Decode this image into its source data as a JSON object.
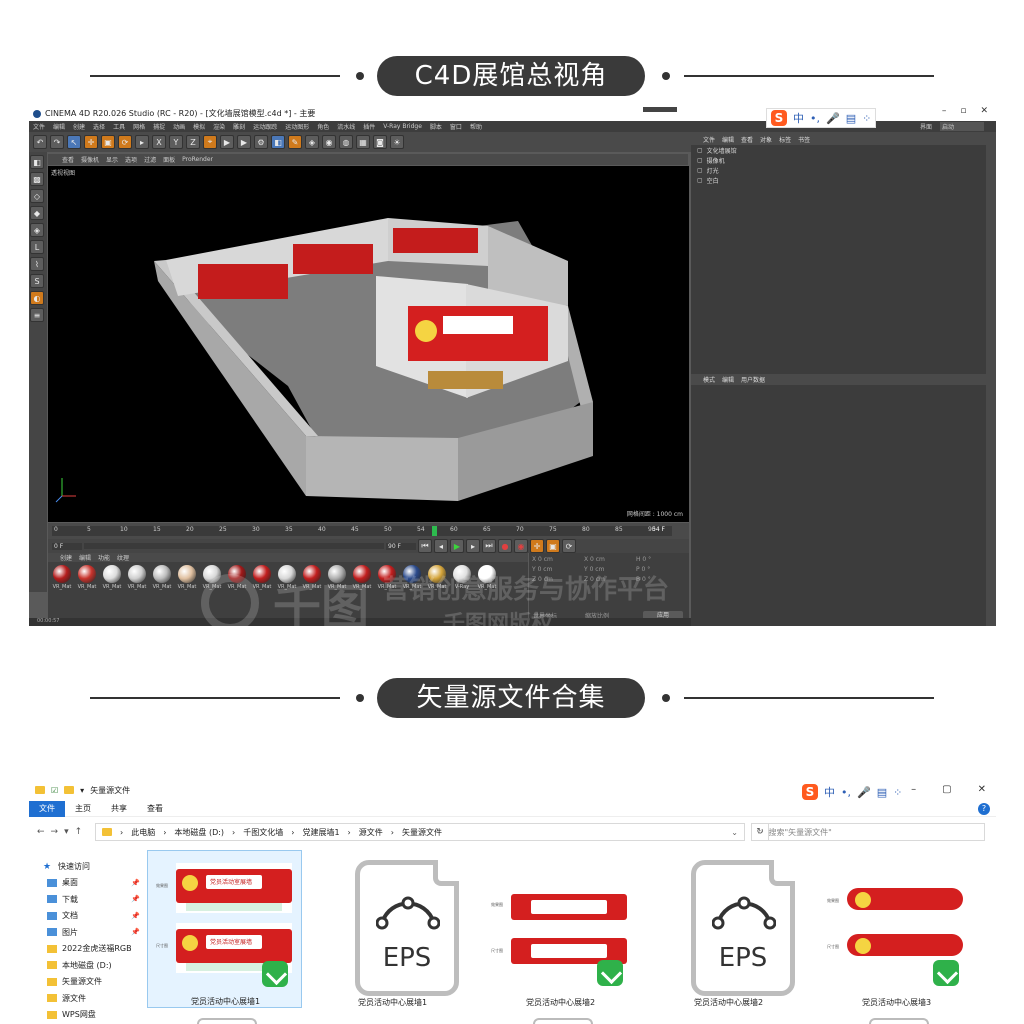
{
  "sections": {
    "c4d_title": "C4D展馆总视角",
    "vector_title": "矢量源文件合集"
  },
  "c4d": {
    "window_title": "CINEMA 4D R20.026 Studio (RC - R20) - [文化墙展馆模型.c4d *] - 主要",
    "menu": [
      "文件",
      "编辑",
      "创建",
      "选择",
      "工具",
      "网格",
      "捕捉",
      "动画",
      "模拟",
      "渲染",
      "雕刻",
      "运动跟踪",
      "运动图形",
      "角色",
      "流水线",
      "插件",
      "V-Ray Bridge",
      "脚本",
      "窗口",
      "帮助"
    ],
    "layout_label": "界面",
    "layout_value": "启动",
    "viewport_tabs": [
      "查看",
      "摄像机",
      "显示",
      "选项",
      "过滤",
      "面板",
      "ProRender"
    ],
    "viewport_name": "透视视图",
    "grid_spacing": "网格间距 : 1000 cm",
    "timeline_ticks": [
      "0",
      "5",
      "10",
      "15",
      "20",
      "25",
      "30",
      "35",
      "40",
      "45",
      "50",
      "54",
      "60",
      "65",
      "70",
      "75",
      "80",
      "85",
      "90"
    ],
    "current_frame": "54 F",
    "frame_start": "0 F",
    "frame_end": "90 F",
    "material_tabs": [
      "创建",
      "编辑",
      "功能",
      "纹理"
    ],
    "material_label": "VR_Mat",
    "material_labels": [
      "VR_Mat",
      "VR_Mat",
      "VR_Mat",
      "VR_Mat",
      "VR_Mat",
      "VR_Mat",
      "VR_Mat",
      "VR_Mat",
      "VR_Mat",
      "VR_Mat",
      "VR_Mat",
      "VR_Mat",
      "VR_Mat",
      "VR_Mat",
      "VR_Mat",
      "VR_Mat",
      "V-Ray",
      "VR_Mat"
    ],
    "coord_labels": [
      "X",
      "Y",
      "Z",
      "X",
      "Y",
      "Z",
      "H",
      "P",
      "B"
    ],
    "coord_value": "0 cm",
    "coord_angle": "0 °",
    "coord_mode": "世界坐标",
    "coord_scale": "缩放比例",
    "apply_label": "应用",
    "object_tabs": [
      "文件",
      "编辑",
      "查看",
      "对象",
      "标签",
      "书签"
    ],
    "objects": [
      "文化墙展馆",
      "摄像机",
      "灯光",
      "空白"
    ],
    "attr_tabs": [
      "模式",
      "编辑",
      "用户数据"
    ],
    "status_time": "00:00:57",
    "maxon_label": "MAXON CINEMA 4D"
  },
  "ime": {
    "logo": "S",
    "items": [
      "中",
      "•,",
      "🎤",
      "▤",
      "⁘"
    ]
  },
  "watermark": {
    "logo_text": "千图",
    "slogan": "营销创意服务与协作平台",
    "sub": "千图网版权"
  },
  "explorer": {
    "window_title": "矢量源文件",
    "ribbon_tabs": [
      "文件",
      "主页",
      "共享",
      "查看"
    ],
    "breadcrumb": [
      "此电脑",
      "本地磁盘 (D:)",
      "千图文化墙",
      "党建展墙1",
      "源文件",
      "矢量源文件"
    ],
    "search_placeholder": "搜索\"矢量源文件\"",
    "nav_items": [
      {
        "label": "快速访问",
        "pinned": false
      },
      {
        "label": "桌面",
        "pinned": true
      },
      {
        "label": "下载",
        "pinned": true
      },
      {
        "label": "文档",
        "pinned": true
      },
      {
        "label": "图片",
        "pinned": true
      },
      {
        "label": "2022金虎送福RGB",
        "pinned": false
      },
      {
        "label": "本地磁盘 (D:)",
        "pinned": false
      },
      {
        "label": "矢量源文件",
        "pinned": false
      },
      {
        "label": "源文件",
        "pinned": false
      },
      {
        "label": "WPS网盘",
        "pinned": false
      }
    ],
    "files": [
      {
        "name": "党员活动中心展墙1",
        "type": "cdr"
      },
      {
        "name": "党员活动中心展墙1",
        "type": "eps"
      },
      {
        "name": "党员活动中心展墙2",
        "type": "cdr"
      },
      {
        "name": "党员活动中心展墙2",
        "type": "eps"
      },
      {
        "name": "党员活动中心展墙3",
        "type": "cdr"
      }
    ],
    "eps_label": "EPS",
    "board_label_top": "效果图",
    "board_label_bottom": "尺寸图",
    "board_text": "党员活动室展墙"
  },
  "colors": {
    "c4d_accent": "#d07a1c",
    "explorer_accent": "#1f6fd1",
    "party_red": "#d41f1f",
    "cdr_green": "#2fb14a"
  }
}
